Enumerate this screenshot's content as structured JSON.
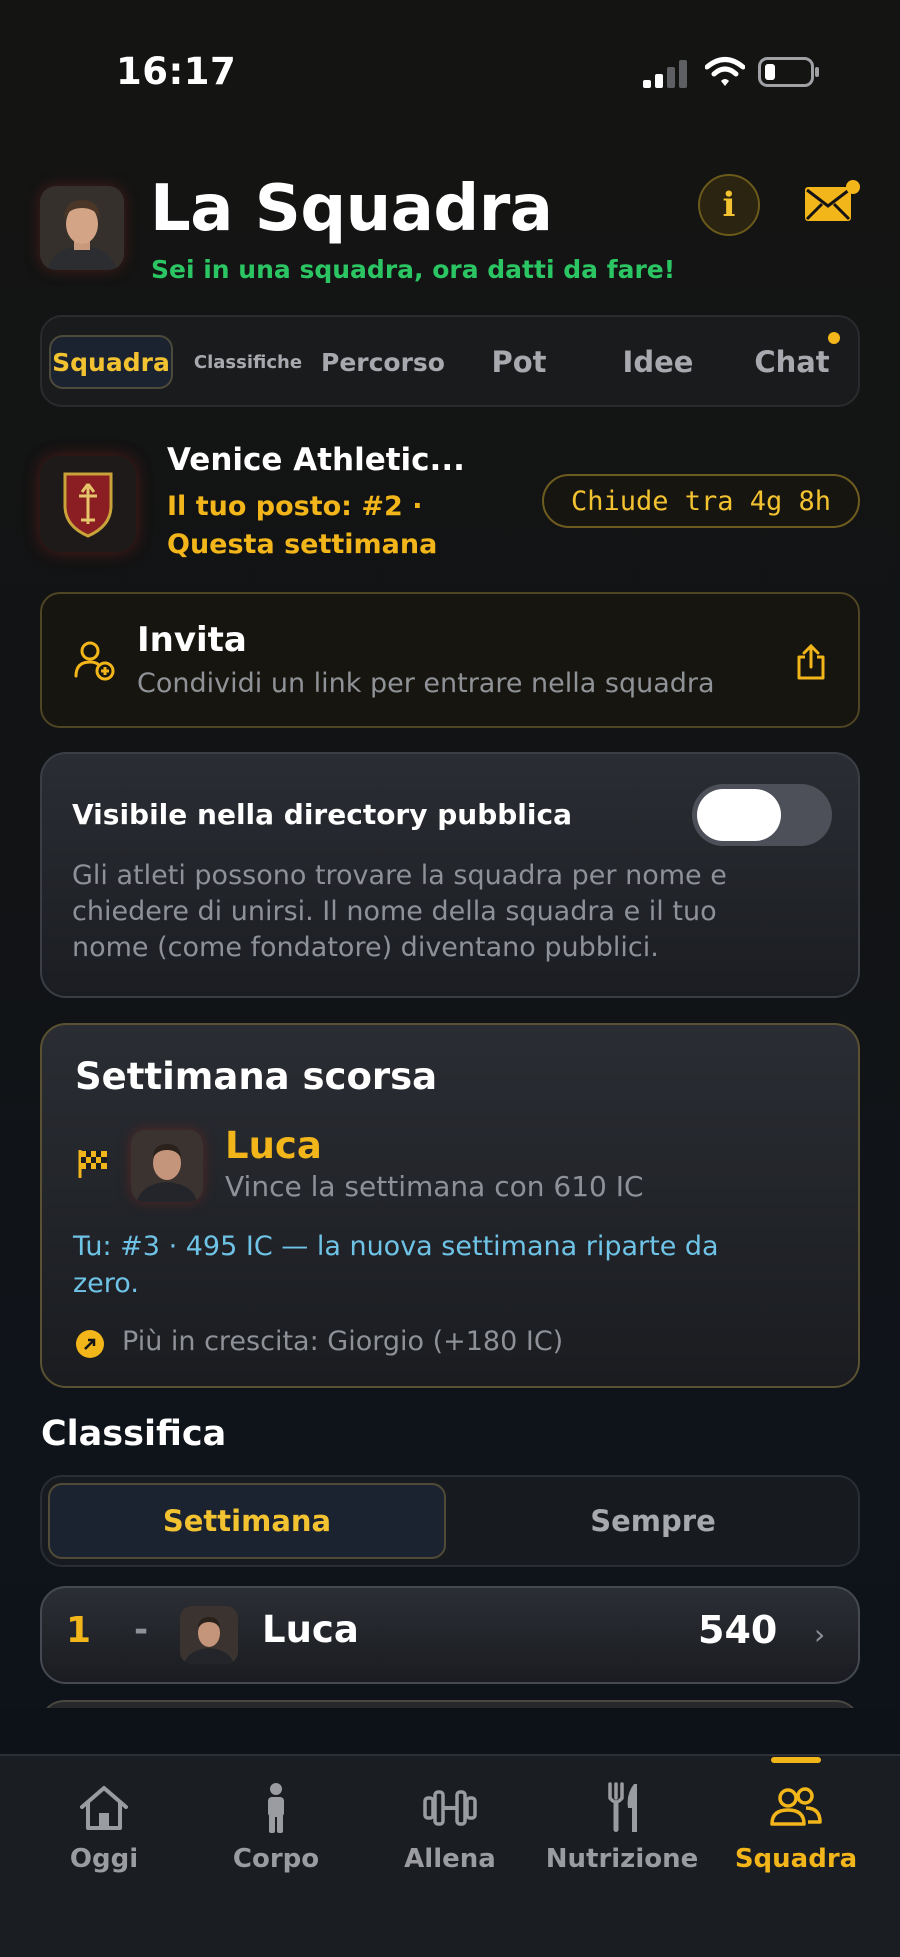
{
  "status_bar": {
    "time": "16:17"
  },
  "header": {
    "title": "La Squadra",
    "subtitle": "Sei in una squadra, ora datti da fare!",
    "info_glyph": "i",
    "icons": [
      "info-icon",
      "mail-icon"
    ]
  },
  "tabs": [
    {
      "label": "Squadra",
      "active": true
    },
    {
      "label": "Classifiche",
      "active": false
    },
    {
      "label": "Percorso",
      "active": false
    },
    {
      "label": "Pot",
      "active": false
    },
    {
      "label": "Idee",
      "active": false
    },
    {
      "label": "Chat",
      "active": false,
      "badge": true
    }
  ],
  "team": {
    "name": "Venice Athletic...",
    "rank_line1": "Il tuo posto: #2 ·",
    "rank_line2": "Questa settimana",
    "closes": "Chiude tra 4g 8h"
  },
  "invite": {
    "title": "Invita",
    "subtitle": "Condividi un link per entrare nella squadra"
  },
  "visibility": {
    "title": "Visibile nella directory pubblica",
    "description": "Gli atleti possono trovare la squadra per nome e chiedere di unirsi. Il nome della squadra e il tuo nome (come fondatore) diventano pubblici.",
    "toggle_on": false
  },
  "last_week": {
    "title": "Settimana scorsa",
    "winner_name": "Luca",
    "winner_sub": "Vince la settimana con 610 IC",
    "you_line": "Tu: #3 · 495 IC — la nuova settimana riparte da zero.",
    "growth_line": "Più in crescita: Giorgio (+180 IC)"
  },
  "leaderboard": {
    "title": "Classifica",
    "segments": [
      {
        "label": "Settimana",
        "active": true
      },
      {
        "label": "Sempre",
        "active": false
      }
    ],
    "rows": [
      {
        "rank": "1",
        "trend": "-",
        "name": "Luca",
        "score": "540"
      }
    ]
  },
  "tabbar": [
    {
      "label": "Oggi",
      "icon": "home-icon",
      "active": false
    },
    {
      "label": "Corpo",
      "icon": "body-icon",
      "active": false
    },
    {
      "label": "Allena",
      "icon": "dumbbell-icon",
      "active": false
    },
    {
      "label": "Nutrizione",
      "icon": "fork-knife-icon",
      "active": false
    },
    {
      "label": "Squadra",
      "icon": "team-icon",
      "active": true
    }
  ],
  "colors": {
    "accent": "#f2b51a",
    "subtitle_green": "#2bc563",
    "info_blue": "#6ec3e6"
  }
}
